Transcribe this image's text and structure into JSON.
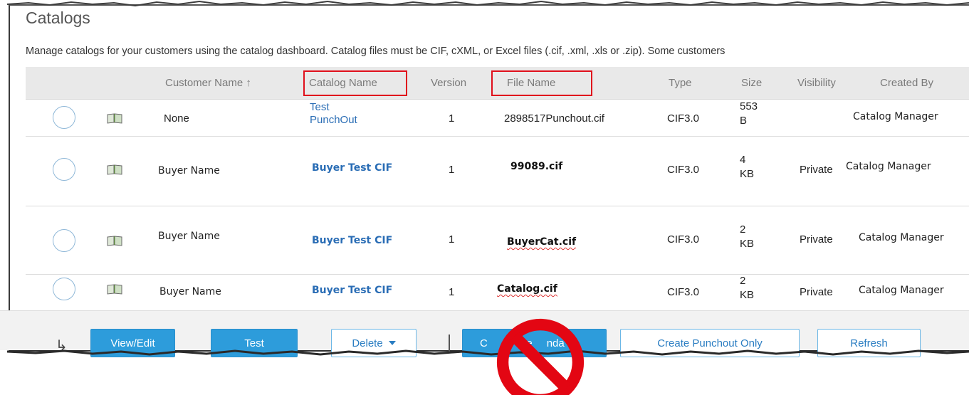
{
  "page": {
    "title": "Catalogs",
    "description": "Manage catalogs for your customers using the catalog dashboard. Catalog files must be CIF, cXML, or Excel files (.cif, .xml, .xls or .zip). Some customers"
  },
  "table": {
    "columns": {
      "customer_name": "Customer Name ↑",
      "catalog_name": "Catalog Name",
      "version": "Version",
      "file_name": "File Name",
      "type": "Type",
      "size": "Size",
      "visibility": "Visibility",
      "created_by": "Created By"
    },
    "highlighted_columns": [
      "Catalog Name",
      "File Name"
    ],
    "highlight_color": "#e0101c",
    "rows": [
      {
        "customer": "None",
        "catalog_line1": "Test",
        "catalog_line2": "PunchOut",
        "version": "1",
        "file_name": "2898517Punchout.cif",
        "type": "CIF3.0",
        "size_num": "553",
        "size_unit": "B",
        "visibility": "",
        "created_by": "Catalog Manager"
      },
      {
        "customer": "Buyer Name",
        "catalog": "Buyer Test CIF",
        "version": "1",
        "file_name": "99089.cif",
        "type": "CIF3.0",
        "size_num": "4",
        "size_unit": "KB",
        "visibility": "Private",
        "created_by": "Catalog Manager"
      },
      {
        "customer": "Buyer Name",
        "catalog": "Buyer Test CIF",
        "version": "1",
        "file_name": "BuyerCat.cif",
        "type": "CIF3.0",
        "size_num": "2",
        "size_unit": "KB",
        "visibility": "Private",
        "created_by": "Catalog Manager"
      },
      {
        "customer": "Buyer Name",
        "catalog": "Buyer Test CIF",
        "version": "1",
        "file_name": "Catalog.cif",
        "type": "CIF3.0",
        "size_num": "2",
        "size_unit": "KB",
        "visibility": "Private",
        "created_by": "Catalog Manager"
      }
    ]
  },
  "footer": {
    "arrow_icon": "↳",
    "buttons": {
      "view_edit": "View/Edit",
      "test": "Test",
      "delete": "Delete",
      "create_update_partial": "C",
      "create_update_partial2": "ate",
      "create_update_partial3": "nda",
      "create_punchout_only": "Create Punchout Only",
      "refresh": "Refresh"
    }
  },
  "overlay": {
    "icon": "prohibited-icon",
    "color": "#e30613"
  },
  "colors": {
    "primary_button": "#2d9cdb",
    "link": "#2a6db5",
    "header_bg": "#e9e9e9"
  }
}
